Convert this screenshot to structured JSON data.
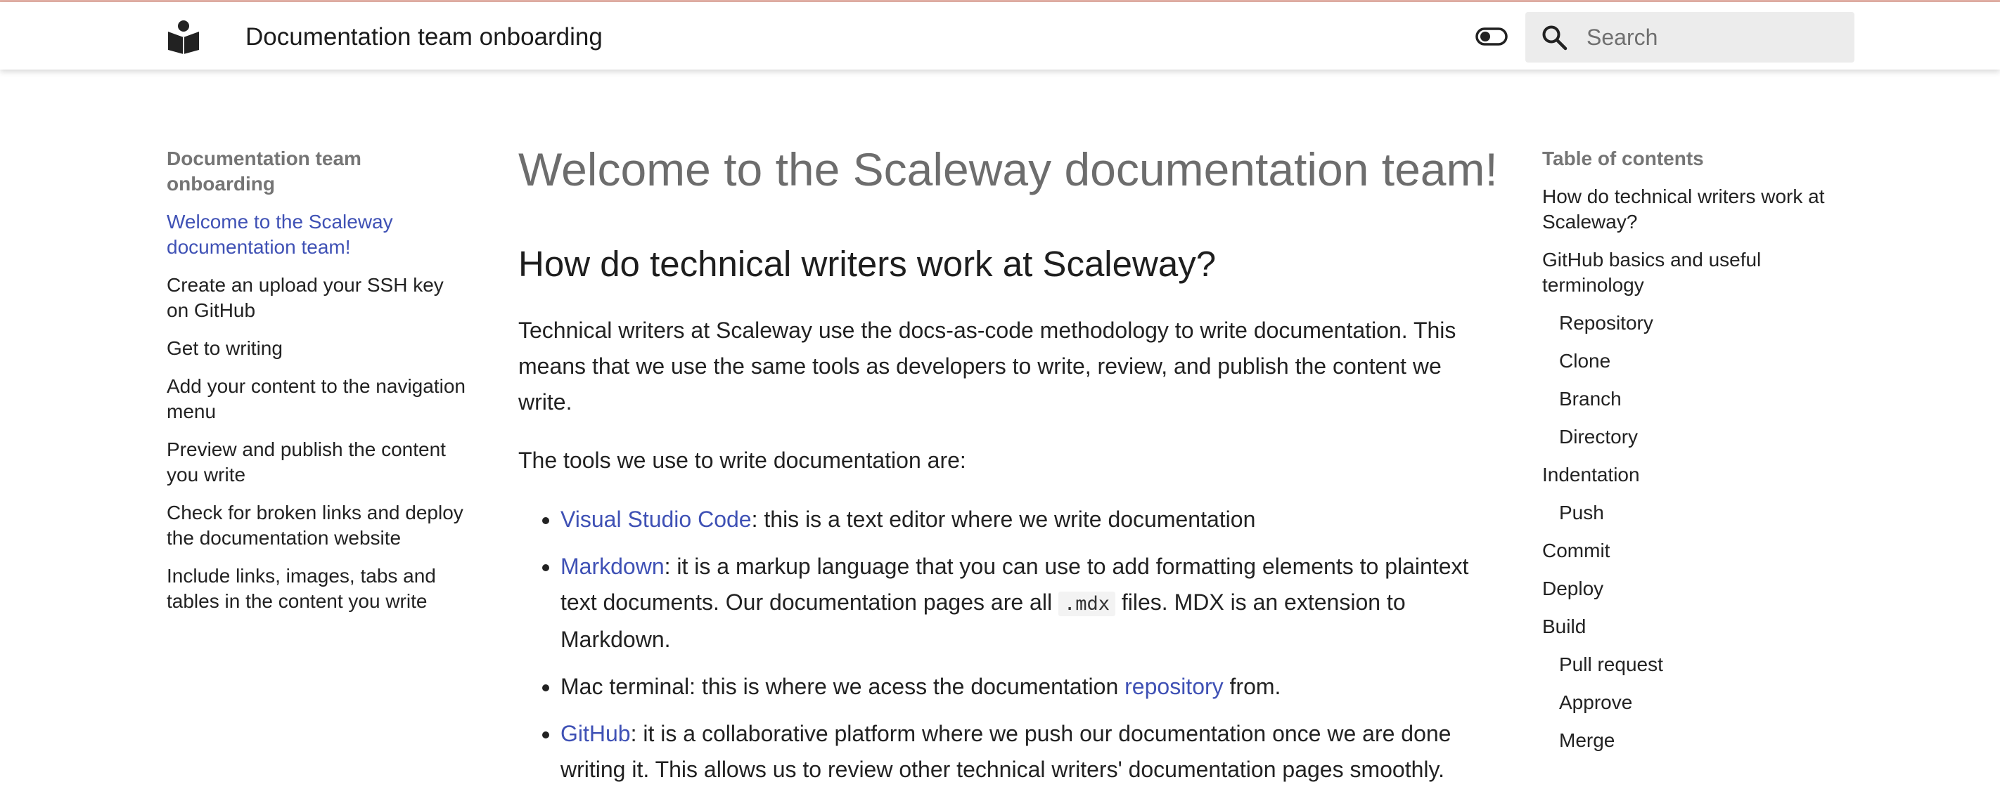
{
  "header": {
    "site_title": "Documentation team onboarding",
    "search_placeholder": "Search",
    "icons": [
      "book-logo-icon",
      "theme-toggle-icon",
      "search-icon"
    ]
  },
  "sidebar": {
    "heading": "Documentation team onboarding",
    "items": [
      {
        "label": "Welcome to the Scaleway documentation team!",
        "active": true
      },
      {
        "label": "Create an upload your SSH key on GitHub",
        "active": false
      },
      {
        "label": "Get to writing",
        "active": false
      },
      {
        "label": "Add your content to the navigation menu",
        "active": false
      },
      {
        "label": "Preview and publish the content you write",
        "active": false
      },
      {
        "label": "Check for broken links and deploy the documentation website",
        "active": false
      },
      {
        "label": "Include links, images, tabs and tables in the content you write",
        "active": false
      }
    ]
  },
  "main": {
    "title": "Welcome to the Scaleway documentation team!",
    "section_heading": "How do technical writers work at Scaleway?",
    "intro": "Technical writers at Scaleway use the docs-as-code methodology to write documentation. This means that we use the same tools as developers to write, review, and publish the content we write.",
    "tools_intro": "The tools we use to write documentation are:",
    "tools": [
      {
        "link": "Visual Studio Code",
        "text": ": this is a text editor where we write documentation"
      },
      {
        "link": "Markdown",
        "text_before_code": ": it is a markup language that you can use to add formatting elements to plaintext text documents. Our documentation pages are all ",
        "code": ".mdx",
        "text_after_code": " files. MDX is an extension to Markdown."
      },
      {
        "text_before_link": "Mac terminal: this is where we acess the documentation ",
        "link": "repository",
        "text_after_link": " from."
      },
      {
        "link": "GitHub",
        "text": ": it is a collaborative platform where we push our documentation once we are done writing it. This allows us to review other technical writers' documentation pages smoothly."
      }
    ]
  },
  "toc": {
    "heading": "Table of contents",
    "items": [
      {
        "label": "How do technical writers work at Scaleway?",
        "level": 1
      },
      {
        "label": "GitHub basics and useful terminology",
        "level": 1
      },
      {
        "label": "Repository",
        "level": 2
      },
      {
        "label": "Clone",
        "level": 2
      },
      {
        "label": "Branch",
        "level": 2
      },
      {
        "label": "Directory",
        "level": 2
      },
      {
        "label": "Indentation",
        "level": 1
      },
      {
        "label": "Push",
        "level": 2
      },
      {
        "label": "Commit",
        "level": 1
      },
      {
        "label": "Deploy",
        "level": 1
      },
      {
        "label": "Build",
        "level": 1
      },
      {
        "label": "Pull request",
        "level": 2
      },
      {
        "label": "Approve",
        "level": 2
      },
      {
        "label": "Merge",
        "level": 2
      }
    ]
  },
  "colors": {
    "link": "#3f51b5",
    "title_gray": "#6d6d6d",
    "search_bg": "#ececec"
  }
}
